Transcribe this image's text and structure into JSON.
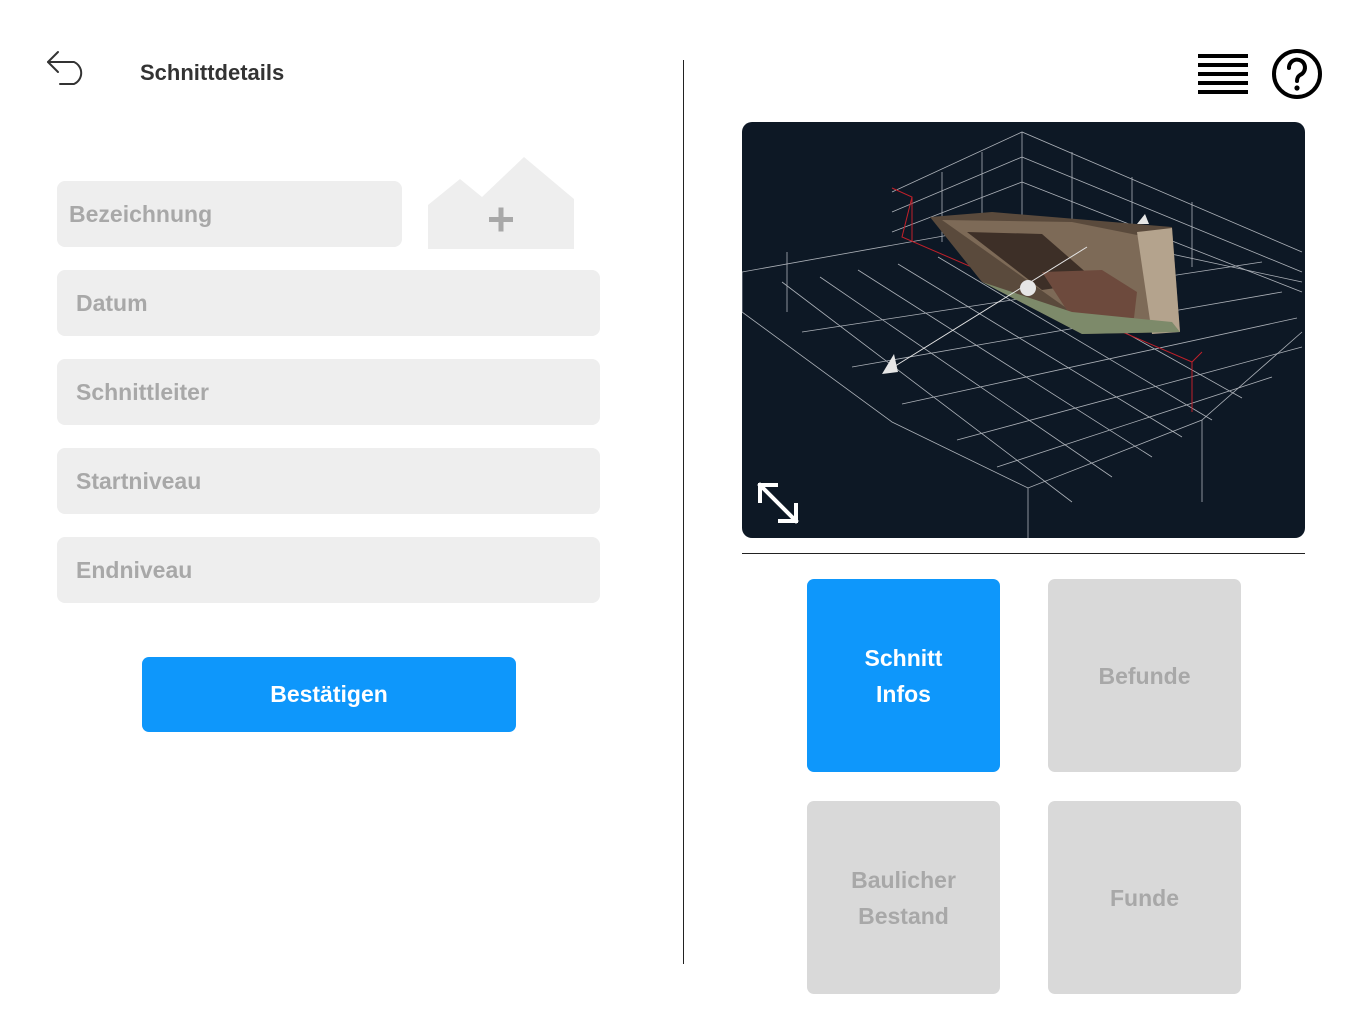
{
  "header": {
    "title": "Schnittdetails",
    "back_icon": "undo-arrow-icon",
    "menu_icon": "hamburger-menu-icon",
    "help_icon": "question-circle-icon"
  },
  "form": {
    "fields": [
      {
        "placeholder": "Bezeichnung"
      },
      {
        "placeholder": "Datum"
      },
      {
        "placeholder": "Schnittleiter"
      },
      {
        "placeholder": "Startniveau"
      },
      {
        "placeholder": "Endniveau"
      }
    ],
    "add_image_icon": "add-image-icon",
    "confirm_label": "Bestätigen"
  },
  "viewer": {
    "description_icon": "3d-model-viewer",
    "expand_icon": "expand-arrows-icon"
  },
  "tiles": [
    {
      "label": "Schnitt\nInfos",
      "active": true
    },
    {
      "label": "Befunde",
      "active": false
    },
    {
      "label": "Baulicher\nBestand",
      "active": false
    },
    {
      "label": "Funde",
      "active": false
    }
  ],
  "colors": {
    "accent": "#0e97fb",
    "field_bg": "#eeeeee",
    "tile_bg": "#d9d9d9",
    "placeholder_text": "#a8a8a8",
    "viewer_bg": "#0d1825"
  }
}
